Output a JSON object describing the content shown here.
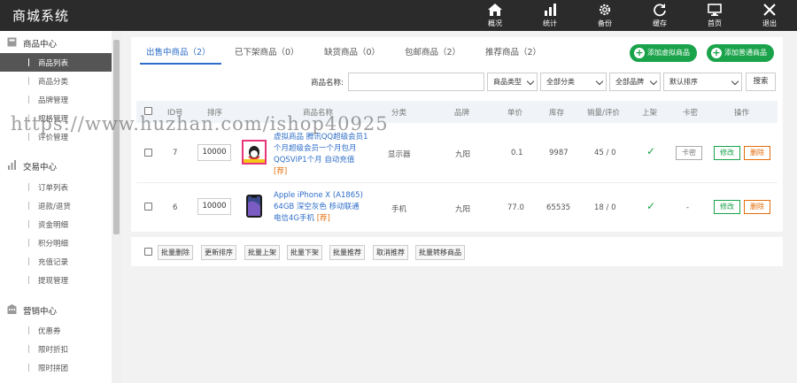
{
  "app": {
    "title": "商城系统"
  },
  "topnav": [
    {
      "label": "概况",
      "icon": "home-icon"
    },
    {
      "label": "统计",
      "icon": "bar-chart-icon"
    },
    {
      "label": "备份",
      "icon": "gear-icon"
    },
    {
      "label": "缓存",
      "icon": "refresh-icon"
    },
    {
      "label": "首页",
      "icon": "monitor-icon"
    },
    {
      "label": "退出",
      "icon": "close-icon"
    }
  ],
  "sidebar": {
    "groups": [
      {
        "title": "商品中心",
        "icon": "box-icon",
        "items": [
          "商品列表",
          "商品分类",
          "品牌管理",
          "规格管理",
          "评价管理"
        ]
      },
      {
        "title": "交易中心",
        "icon": "bar-chart-icon",
        "items": [
          "订单列表",
          "退款/退货",
          "资金明细",
          "积分明细",
          "充值记录",
          "提现管理"
        ]
      },
      {
        "title": "营销中心",
        "icon": "building-icon",
        "items": [
          "优惠券",
          "限时折扣",
          "限时拼团"
        ]
      }
    ],
    "active_item": "商品列表"
  },
  "tabs": [
    "出售中商品（2）",
    "已下架商品（0）",
    "缺货商品（0）",
    "包邮商品（2）",
    "推荐商品（2）"
  ],
  "actions": {
    "add_virtual": "添加虚拟商品",
    "add_normal": "添加普通商品"
  },
  "search": {
    "label": "商品名称:",
    "value": "",
    "type_select": "商品类型",
    "category_select": "全部分类",
    "brand_select": "全部品牌",
    "sort_select": "默认排序",
    "button": "搜索"
  },
  "table": {
    "headers": [
      "ID号",
      "排序",
      "商品名称",
      "分类",
      "品牌",
      "单价",
      "库存",
      "销量/评价",
      "上架",
      "卡密",
      "操作"
    ],
    "rows": [
      {
        "id": "7",
        "sort": "10000",
        "name": "虚拟商品 腾讯QQ超级会员1个月超级会员一个月包月QQSVIP1个月 自动充值",
        "name_lines": [
          "虚拟商品 腾讯QQ超级会员1",
          "个月超级会员一个月包月",
          "QQSVIP1个月 自动充值"
        ],
        "tag": "[荐]",
        "category": "显示器",
        "brand": "九阳",
        "price": "0.1",
        "stock": "9987",
        "sales_reviews": "45 / 0",
        "on_shelf": true,
        "card": "卡密",
        "edit": "修改",
        "delete": "删除"
      },
      {
        "id": "6",
        "sort": "10000",
        "name": "Apple iPhone X (A1865) 64GB 深空灰色 移动联通电信4G手机",
        "name_lines": [
          "Apple iPhone X (A1865)",
          "64GB 深空灰色 移动联通",
          "电信4G手机 "
        ],
        "tag": "[荐]",
        "category": "手机",
        "brand": "九阳",
        "price": "77.0",
        "stock": "65535",
        "sales_reviews": "18 / 0",
        "on_shelf": true,
        "card": "-",
        "edit": "修改",
        "delete": "删除"
      }
    ]
  },
  "bulk_actions": [
    "批量删除",
    "更新排序",
    "批量上架",
    "批量下架",
    "批量推荐",
    "取消推荐",
    "批量转移商品"
  ],
  "watermark": "https://www.huzhan.com/ishop40925",
  "colors": {
    "accent": "#2e6ec8",
    "green": "#1aa34a",
    "orange": "#e36c09",
    "topbar": "#2b2b2b"
  }
}
